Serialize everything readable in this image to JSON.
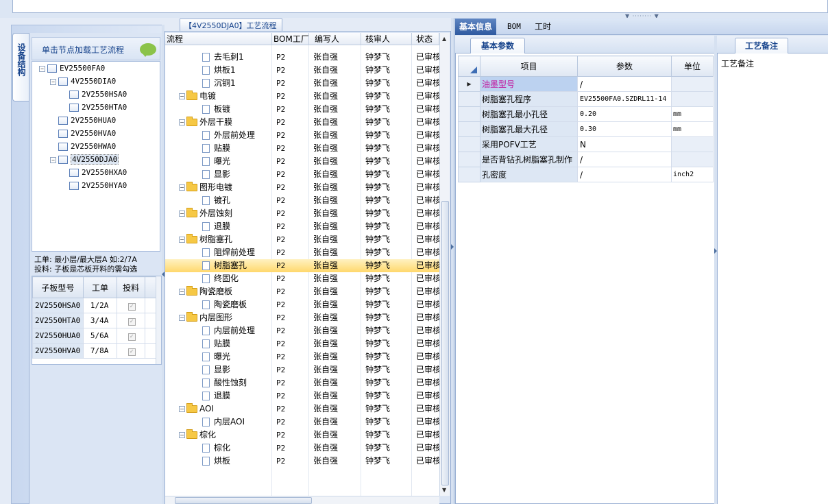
{
  "left_panel": {
    "vertical_tab": "设备结构",
    "load_tip": "单击节点加载工艺流程",
    "tree": [
      {
        "label": "EV25500FA0",
        "depth": 0,
        "expanded": true
      },
      {
        "label": "4V2550DIA0",
        "depth": 1,
        "expanded": true
      },
      {
        "label": "2V2550HSA0",
        "depth": 2
      },
      {
        "label": "2V2550HTA0",
        "depth": 2
      },
      {
        "label": "2V2550HUA0",
        "depth": 1
      },
      {
        "label": "2V2550HVA0",
        "depth": 1
      },
      {
        "label": "2V2550HWA0",
        "depth": 1
      },
      {
        "label": "4V2550DJA0",
        "depth": 1,
        "expanded": true,
        "selected": true
      },
      {
        "label": "2V2550HXA0",
        "depth": 2
      },
      {
        "label": "2V2550HYA0",
        "depth": 2
      }
    ],
    "note_line1": "工单: 最小层/最大层A 如:2/7A",
    "note_line2": "投料: 子板是芯板开料的需勾选",
    "sub_grid": {
      "headers": [
        "子板型号",
        "工单",
        "投料"
      ],
      "rows": [
        [
          "2V2550HSA0",
          "1/2A",
          "✓"
        ],
        [
          "2V2550HTA0",
          "3/4A",
          "✓"
        ],
        [
          "2V2550HUA0",
          "5/6A",
          "✓"
        ],
        [
          "2V2550HVA0",
          "7/8A",
          "✓"
        ]
      ]
    }
  },
  "flow_panel": {
    "tab_label": "【4V2550DJA0】工艺流程",
    "headers": [
      "流程",
      "BOM工厂",
      "编写人",
      "核审人",
      "状态"
    ],
    "rows": [
      {
        "name": "去毛刺1",
        "type": "step",
        "bom": "P2",
        "writer": "张自强",
        "reviewer": "钟梦飞",
        "status": "已审核"
      },
      {
        "name": "烘板1",
        "type": "step",
        "bom": "P2",
        "writer": "张自强",
        "reviewer": "钟梦飞",
        "status": "已审核"
      },
      {
        "name": "沉铜1",
        "type": "step",
        "bom": "P2",
        "writer": "张自强",
        "reviewer": "钟梦飞",
        "status": "已审核"
      },
      {
        "name": "电镀",
        "type": "group",
        "bom": "P2",
        "writer": "张自强",
        "reviewer": "钟梦飞",
        "status": "已审核"
      },
      {
        "name": "板镀",
        "type": "step",
        "bom": "P2",
        "writer": "张自强",
        "reviewer": "钟梦飞",
        "status": "已审核"
      },
      {
        "name": "外层干膜",
        "type": "group",
        "bom": "P2",
        "writer": "张自强",
        "reviewer": "钟梦飞",
        "status": "已审核"
      },
      {
        "name": "外层前处理",
        "type": "step",
        "bom": "P2",
        "writer": "张自强",
        "reviewer": "钟梦飞",
        "status": "已审核"
      },
      {
        "name": "贴膜",
        "type": "step",
        "bom": "P2",
        "writer": "张自强",
        "reviewer": "钟梦飞",
        "status": "已审核"
      },
      {
        "name": "曝光",
        "type": "step",
        "bom": "P2",
        "writer": "张自强",
        "reviewer": "钟梦飞",
        "status": "已审核"
      },
      {
        "name": "显影",
        "type": "step",
        "bom": "P2",
        "writer": "张自强",
        "reviewer": "钟梦飞",
        "status": "已审核"
      },
      {
        "name": "图形电镀",
        "type": "group",
        "bom": "P2",
        "writer": "张自强",
        "reviewer": "钟梦飞",
        "status": "已审核"
      },
      {
        "name": "镀孔",
        "type": "step",
        "bom": "P2",
        "writer": "张自强",
        "reviewer": "钟梦飞",
        "status": "已审核"
      },
      {
        "name": "外层蚀刻",
        "type": "group",
        "bom": "P2",
        "writer": "张自强",
        "reviewer": "钟梦飞",
        "status": "已审核"
      },
      {
        "name": "退膜",
        "type": "step",
        "bom": "P2",
        "writer": "张自强",
        "reviewer": "钟梦飞",
        "status": "已审核"
      },
      {
        "name": "树脂塞孔",
        "type": "group",
        "bom": "P2",
        "writer": "张自强",
        "reviewer": "钟梦飞",
        "status": "已审核"
      },
      {
        "name": "阻焊前处理",
        "type": "step",
        "bom": "P2",
        "writer": "张自强",
        "reviewer": "钟梦飞",
        "status": "已审核"
      },
      {
        "name": "树脂塞孔",
        "type": "step",
        "bom": "P2",
        "writer": "张自强",
        "reviewer": "钟梦飞",
        "status": "已审核",
        "selected": true
      },
      {
        "name": "终固化",
        "type": "step",
        "bom": "P2",
        "writer": "张自强",
        "reviewer": "钟梦飞",
        "status": "已审核"
      },
      {
        "name": "陶瓷磨板",
        "type": "group",
        "bom": "P2",
        "writer": "张自强",
        "reviewer": "钟梦飞",
        "status": "已审核"
      },
      {
        "name": "陶瓷磨板",
        "type": "step",
        "bom": "P2",
        "writer": "张自强",
        "reviewer": "钟梦飞",
        "status": "已审核"
      },
      {
        "name": "内层图形",
        "type": "group",
        "bom": "P2",
        "writer": "张自强",
        "reviewer": "钟梦飞",
        "status": "已审核"
      },
      {
        "name": "内层前处理",
        "type": "step",
        "bom": "P2",
        "writer": "张自强",
        "reviewer": "钟梦飞",
        "status": "已审核"
      },
      {
        "name": "贴膜",
        "type": "step",
        "bom": "P2",
        "writer": "张自强",
        "reviewer": "钟梦飞",
        "status": "已审核"
      },
      {
        "name": "曝光",
        "type": "step",
        "bom": "P2",
        "writer": "张自强",
        "reviewer": "钟梦飞",
        "status": "已审核"
      },
      {
        "name": "显影",
        "type": "step",
        "bom": "P2",
        "writer": "张自强",
        "reviewer": "钟梦飞",
        "status": "已审核"
      },
      {
        "name": "酸性蚀刻",
        "type": "step",
        "bom": "P2",
        "writer": "张自强",
        "reviewer": "钟梦飞",
        "status": "已审核"
      },
      {
        "name": "退膜",
        "type": "step",
        "bom": "P2",
        "writer": "张自强",
        "reviewer": "钟梦飞",
        "status": "已审核"
      },
      {
        "name": "AOI",
        "type": "group",
        "bom": "P2",
        "writer": "张自强",
        "reviewer": "钟梦飞",
        "status": "已审核"
      },
      {
        "name": "内层AOI",
        "type": "step",
        "bom": "P2",
        "writer": "张自强",
        "reviewer": "钟梦飞",
        "status": "已审核"
      },
      {
        "name": "棕化",
        "type": "group",
        "bom": "P2",
        "writer": "张自强",
        "reviewer": "钟梦飞",
        "status": "已审核"
      },
      {
        "name": "棕化",
        "type": "step",
        "bom": "P2",
        "writer": "张自强",
        "reviewer": "钟梦飞",
        "status": "已审核"
      },
      {
        "name": "烘板",
        "type": "step",
        "bom": "P2",
        "writer": "张自强",
        "reviewer": "钟梦飞",
        "status": "已审核"
      }
    ]
  },
  "right_panel": {
    "tabs": [
      "基本信息",
      "BOM",
      "工时"
    ],
    "active_tab": 0,
    "params_tab": "基本参数",
    "param_headers": [
      "项目",
      "参数",
      "单位"
    ],
    "params": [
      {
        "item": "油墨型号",
        "value": "/",
        "unit": "",
        "current": true
      },
      {
        "item": "树脂塞孔程序",
        "value": "EV25500FA0.SZDRL11-14",
        "unit": ""
      },
      {
        "item": "树脂塞孔最小孔径",
        "value": "0.20",
        "unit": "mm"
      },
      {
        "item": "树脂塞孔最大孔径",
        "value": "0.30",
        "unit": "mm"
      },
      {
        "item": "采用POFV工艺",
        "value": "N",
        "unit": ""
      },
      {
        "item": "是否背钻孔树脂塞孔制作",
        "value": "/",
        "unit": ""
      },
      {
        "item": "孔密度",
        "value": "/",
        "unit": "inch2"
      }
    ],
    "remark_tab": "工艺备注",
    "remark_label": "工艺备注"
  },
  "colors": {
    "accent": "#2f5aa0",
    "selected_row": "#ffd86c",
    "highlight_text": "#c0139b",
    "folder": "#f6c845"
  }
}
